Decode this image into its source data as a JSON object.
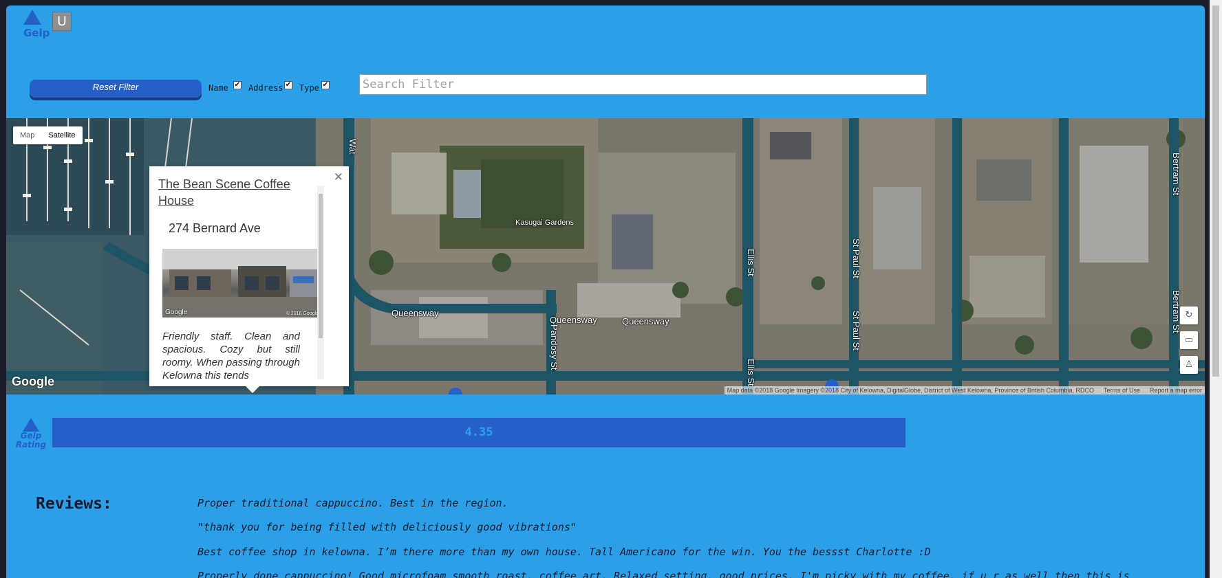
{
  "header": {
    "logo_text": "Gelp",
    "user_button": "U"
  },
  "filter": {
    "reset_label": "Reset Filter",
    "options": [
      {
        "label": "Name",
        "checked": true
      },
      {
        "label": "Address",
        "checked": true
      },
      {
        "label": "Type",
        "checked": true
      }
    ],
    "search_placeholder": "Search Filter"
  },
  "map": {
    "type_options": [
      "Map",
      "Satellite"
    ],
    "active_type": "Satellite",
    "labels": {
      "kasugai": "Kasugai Gardens",
      "queensway1": "Queensway",
      "queensway2": "Queensway",
      "queensway3": "Queensway",
      "pandosy": "Pandosy St",
      "ellis1": "Ellis St",
      "ellis2": "Ellis St",
      "stpaul1": "St Paul St",
      "stpaul2": "St Paul St",
      "bertram1": "Bertram St",
      "bertram2": "Bertram St",
      "water": "Wat"
    },
    "google_logo": "Google",
    "attribution": "Map data ©2018 Google Imagery ©2018 City of Kelowna, DigitalGlobe, District of West Kelowna, Province of British Columbia, RDCO",
    "terms": "Terms of Use",
    "report": "Report a map error"
  },
  "info_window": {
    "title": "The Bean Scene Coffee House",
    "address": "274 Bernard Ave",
    "photo_credit": "Google",
    "photo_copyright": "© 2016 Google",
    "review": "Friendly staff. Clean and spacious. Cozy but still roomy. When passing through Kelowna this tends"
  },
  "rating": {
    "logo_top": "Gelp",
    "logo_bottom": "Rating",
    "value": "4.35",
    "fraction": 0.87
  },
  "reviews": {
    "heading": "Reviews:",
    "items": [
      "Proper traditional cappuccino. Best in the region.",
      "\"thank you for being filled with deliciously good vibrations\"",
      "Best coffee shop in kelowna. I’m there more than my own house. Tall Americano for the win. You the bessst Charlotte :D",
      "Properly done cappuccino! Good microfoam smooth roast, coffee art, Relaxed setting, good prices. I'm picky with my coffee, if u r as well then this is"
    ]
  }
}
